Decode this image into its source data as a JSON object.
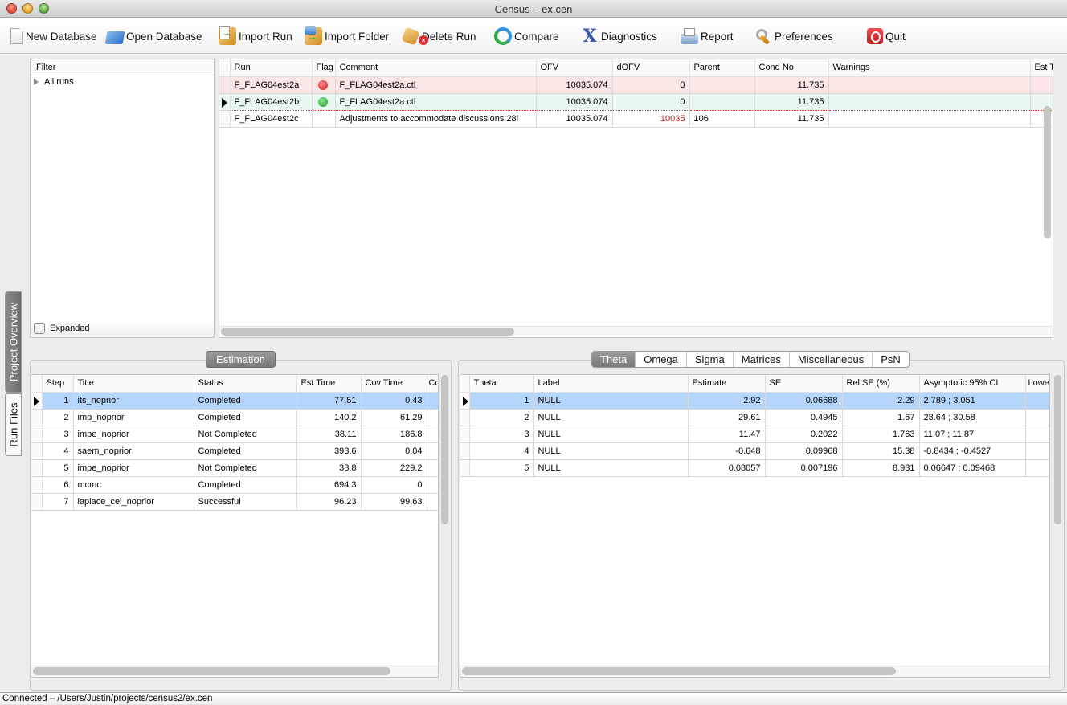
{
  "window": {
    "title": "Census – ex.cen"
  },
  "toolbar": {
    "items": [
      {
        "label": "New Database",
        "icon": "new-document-icon"
      },
      {
        "label": "Open Database",
        "icon": "open-folder-icon"
      },
      {
        "label": "Import Run",
        "icon": "import-run-icon"
      },
      {
        "label": "Import Folder",
        "icon": "import-folder-icon"
      },
      {
        "label": "Delete Run",
        "icon": "delete-run-icon"
      },
      {
        "label": "Compare",
        "icon": "compare-refresh-icon"
      },
      {
        "label": "Diagnostics",
        "icon": "diagnostics-x-icon"
      },
      {
        "label": "Report",
        "icon": "printer-icon"
      },
      {
        "label": "Preferences",
        "icon": "wrench-icon"
      },
      {
        "label": "Quit",
        "icon": "power-icon"
      }
    ]
  },
  "side_tabs": {
    "project_overview": "Project Overview",
    "run_files": "Run Files"
  },
  "filter": {
    "header": "Filter",
    "tree_root": "All runs",
    "expanded_label": "Expanded",
    "expanded_checked": false
  },
  "runs": {
    "columns": [
      "Run",
      "Flag",
      "Comment",
      "OFV",
      "dOFV",
      "Parent",
      "Cond No",
      "Warnings",
      "Est T"
    ],
    "rows": [
      {
        "run": "F_FLAG04est2a",
        "flag": "red",
        "comment": "F_FLAG04est2a.ctl",
        "ofv": "10035.074",
        "dofv": "0",
        "parent": "",
        "cond_no": "11.735",
        "warnings": "",
        "est_t": ""
      },
      {
        "run": "F_FLAG04est2b",
        "flag": "green",
        "comment": "F_FLAG04est2a.ctl",
        "ofv": "10035.074",
        "dofv": "0",
        "parent": "",
        "cond_no": "11.735",
        "warnings": "",
        "est_t": ""
      },
      {
        "run": "F_FLAG04est2c",
        "flag": "",
        "comment": "Adjustments to accommodate discussions 28l",
        "ofv": "10035.074",
        "dofv": "10035",
        "parent": "106",
        "cond_no": "11.735",
        "warnings": "",
        "est_t": ""
      }
    ],
    "flag_colors": {
      "red": "#d42a2a",
      "green": "#2aa83a"
    },
    "selected_row": 1
  },
  "estimation": {
    "tab_label": "Estimation",
    "columns": [
      "Step",
      "Title",
      "Status",
      "Est Time",
      "Cov Time",
      "Co"
    ],
    "rows": [
      {
        "step": "1",
        "title": "its_noprior",
        "status": "Completed",
        "est_time": "77.51",
        "cov_time": "0.43"
      },
      {
        "step": "2",
        "title": "imp_noprior",
        "status": "Completed",
        "est_time": "140.2",
        "cov_time": "61.29"
      },
      {
        "step": "3",
        "title": "impe_noprior",
        "status": "Not Completed",
        "est_time": "38.11",
        "cov_time": "186.8"
      },
      {
        "step": "4",
        "title": "saem_noprior",
        "status": "Completed",
        "est_time": "393.6",
        "cov_time": "0.04"
      },
      {
        "step": "5",
        "title": "impe_noprior",
        "status": "Not Completed",
        "est_time": "38.8",
        "cov_time": "229.2"
      },
      {
        "step": "6",
        "title": "mcmc",
        "status": "Completed",
        "est_time": "694.3",
        "cov_time": "0"
      },
      {
        "step": "7",
        "title": "laplace_cei_noprior",
        "status": "Successful",
        "est_time": "96.23",
        "cov_time": "99.63"
      }
    ],
    "selected_row": 0
  },
  "params": {
    "tabs": [
      "Theta",
      "Omega",
      "Sigma",
      "Matrices",
      "Miscellaneous",
      "PsN"
    ],
    "active_tab": "Theta",
    "columns": [
      "Theta",
      "Label",
      "Estimate",
      "SE",
      "Rel SE (%)",
      "Asymptotic 95% CI",
      "Lowe"
    ],
    "rows": [
      {
        "theta": "1",
        "label": "NULL",
        "estimate": "2.92",
        "se": "0.06688",
        "rel_se": "2.29",
        "ci": "2.789 ; 3.051"
      },
      {
        "theta": "2",
        "label": "NULL",
        "estimate": "29.61",
        "se": "0.4945",
        "rel_se": "1.67",
        "ci": "28.64 ; 30.58"
      },
      {
        "theta": "3",
        "label": "NULL",
        "estimate": "11.47",
        "se": "0.2022",
        "rel_se": "1.763",
        "ci": "11.07 ; 11.87"
      },
      {
        "theta": "4",
        "label": "NULL",
        "estimate": "-0.648",
        "se": "0.09968",
        "rel_se": "15.38",
        "ci": "-0.8434 ; -0.4527"
      },
      {
        "theta": "5",
        "label": "NULL",
        "estimate": "0.08057",
        "se": "0.007196",
        "rel_se": "8.931",
        "ci": "0.06647 ; 0.09468"
      }
    ],
    "selected_row": 0
  },
  "status": {
    "text": "Connected – /Users/Justin/projects/census2/ex.cen"
  }
}
